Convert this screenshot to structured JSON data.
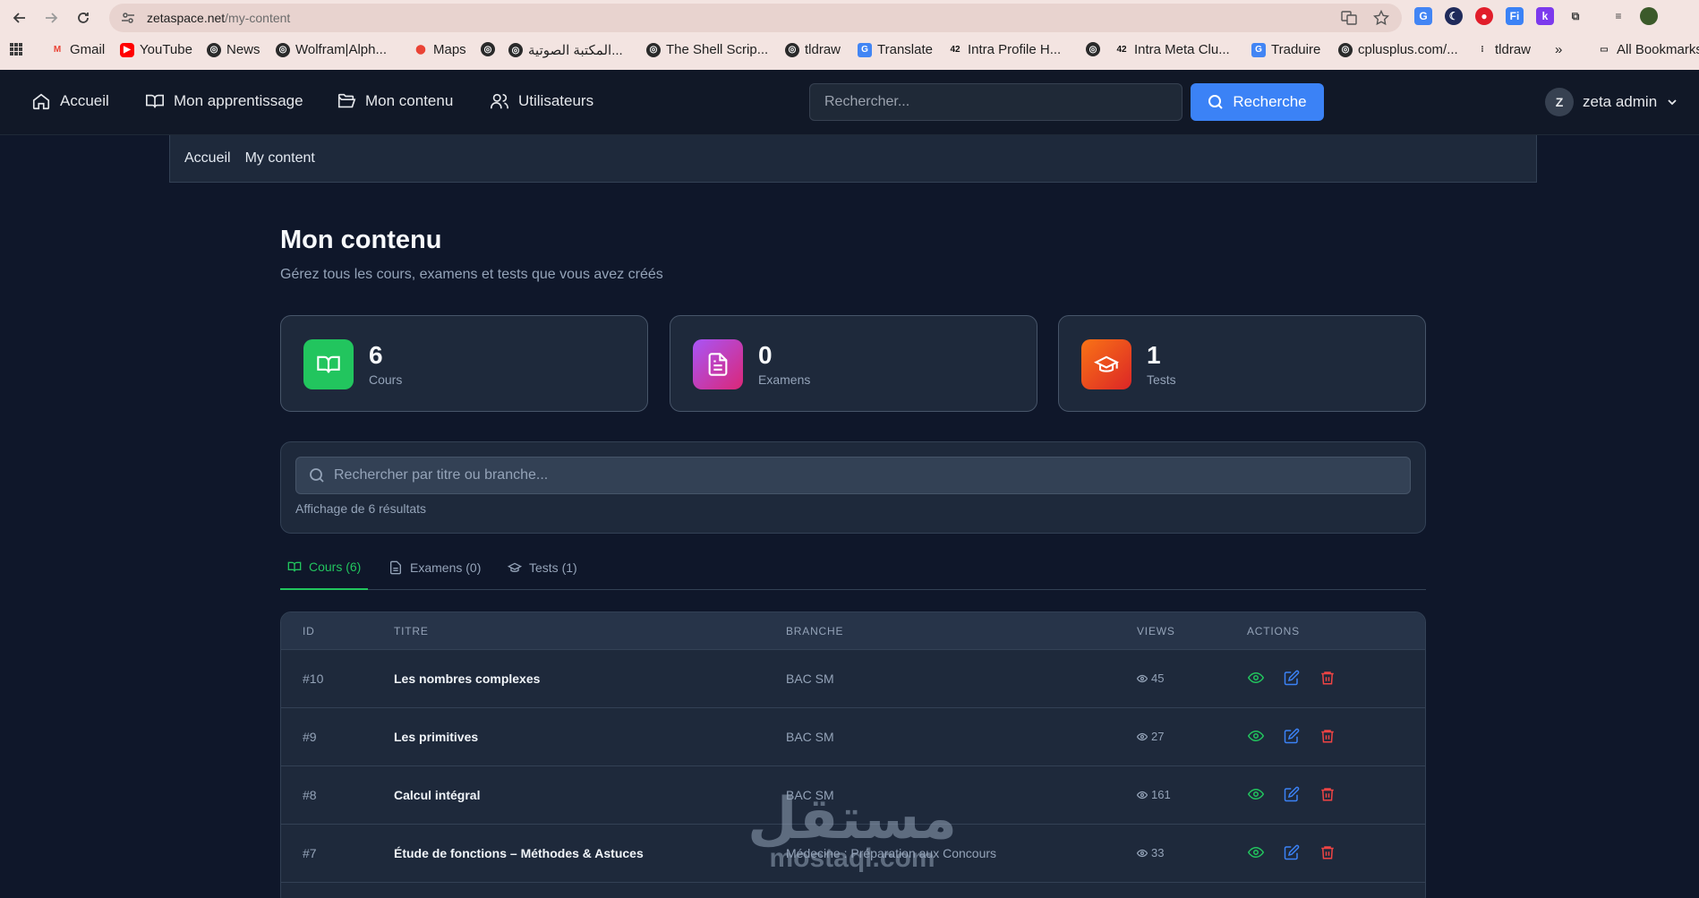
{
  "browser": {
    "url_host": "zetaspace.net",
    "url_path": "/my-content",
    "bookmarks": [
      "Gmail",
      "YouTube",
      "News",
      "Wolfram|Alph...",
      "Maps",
      "المكتبة الصوتية...",
      "The Shell Scrip...",
      "tldraw",
      "Translate",
      "Intra Profile H...",
      "Intra Meta Clu...",
      "Traduire",
      "cplusplus.com/...",
      "tldraw"
    ],
    "all_bookmarks": "All Bookmarks",
    "more": "»"
  },
  "nav": {
    "home": "Accueil",
    "learning": "Mon apprentissage",
    "content": "Mon contenu",
    "users": "Utilisateurs",
    "search_placeholder": "Rechercher...",
    "search_button": "Recherche",
    "user_initial": "Z",
    "user_name": "zeta admin"
  },
  "breadcrumb": {
    "home": "Accueil",
    "current": "My content"
  },
  "page": {
    "title": "Mon contenu",
    "subtitle": "Gérez tous les cours, examens et tests que vous avez créés"
  },
  "stats": [
    {
      "value": "6",
      "label": "Cours",
      "color": "#22c55e"
    },
    {
      "value": "0",
      "label": "Examens",
      "color": "#c026d3"
    },
    {
      "value": "1",
      "label": "Tests",
      "color": "#f97316"
    }
  ],
  "filter": {
    "placeholder": "Rechercher par titre ou branche...",
    "results": "Affichage de 6 résultats"
  },
  "tabs": [
    {
      "label": "Cours (6)",
      "active": true
    },
    {
      "label": "Examens (0)",
      "active": false
    },
    {
      "label": "Tests (1)",
      "active": false
    }
  ],
  "table": {
    "headers": [
      "ID",
      "TITRE",
      "BRANCHE",
      "VIEWS",
      "ACTIONS"
    ],
    "rows": [
      {
        "id": "#10",
        "title": "Les nombres complexes",
        "branch": "BAC SM",
        "views": "45"
      },
      {
        "id": "#9",
        "title": "Les primitives",
        "branch": "BAC SM",
        "views": "27"
      },
      {
        "id": "#8",
        "title": "Calcul intégral",
        "branch": "BAC SM",
        "views": "161"
      },
      {
        "id": "#7",
        "title": "Étude de fonctions – Méthodes & Astuces",
        "branch": "Médecine : Préparation aux Concours",
        "views": "33"
      }
    ]
  },
  "watermark": {
    "arabic": "مستقل",
    "latin": "mostaql.com"
  }
}
